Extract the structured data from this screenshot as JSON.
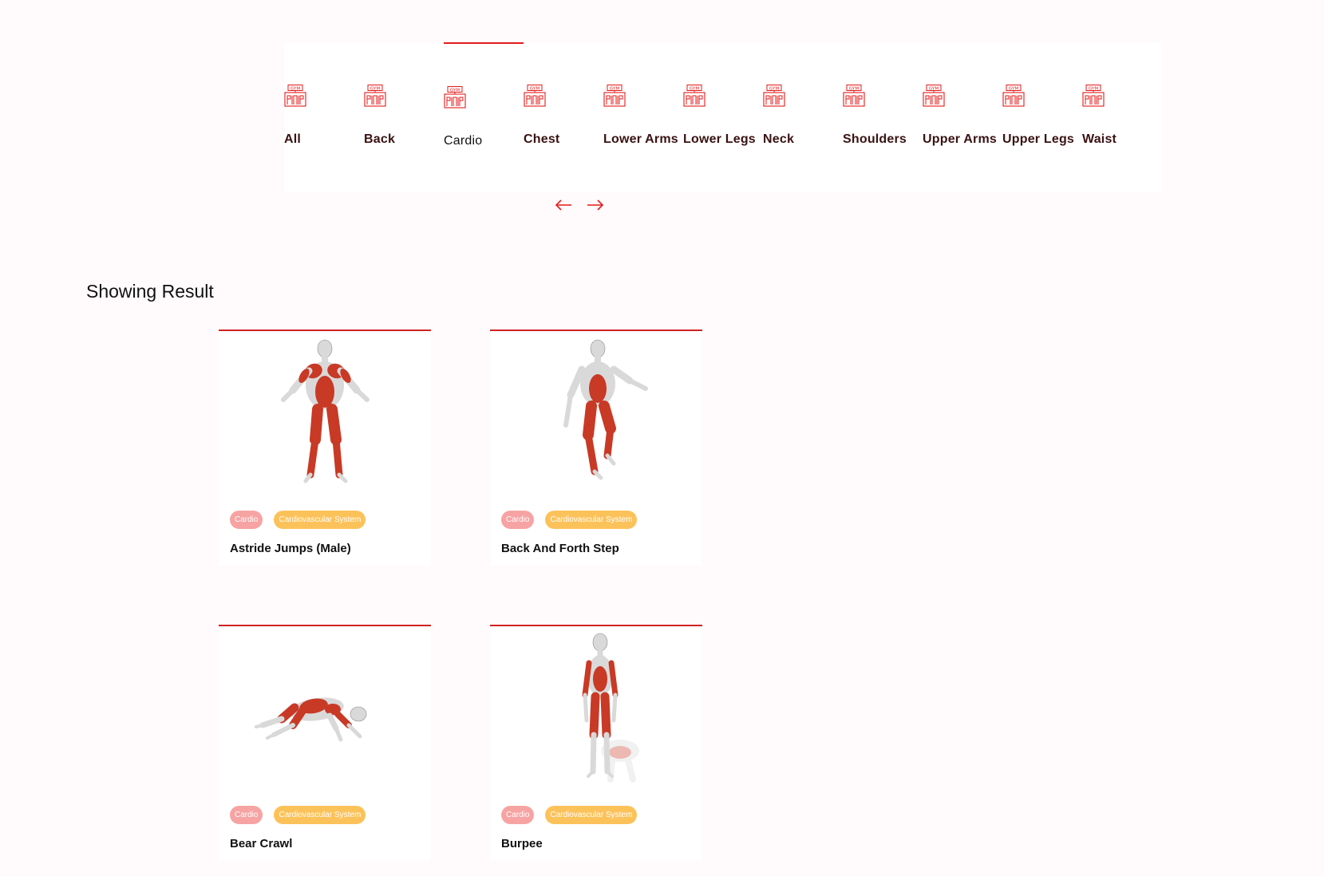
{
  "categories": [
    {
      "label": "All",
      "icon": "gym-equipment-icon"
    },
    {
      "label": "Back",
      "icon": "gym-equipment-icon"
    },
    {
      "label": "Cardio",
      "icon": "gym-equipment-icon",
      "active": true
    },
    {
      "label": "Chest",
      "icon": "gym-equipment-icon"
    },
    {
      "label": "Lower Arms",
      "icon": "gym-equipment-icon"
    },
    {
      "label": "Lower Legs",
      "icon": "gym-equipment-icon"
    },
    {
      "label": "Neck",
      "icon": "gym-equipment-icon"
    },
    {
      "label": "Shoulders",
      "icon": "gym-equipment-icon"
    },
    {
      "label": "Upper Arms",
      "icon": "gym-equipment-icon"
    },
    {
      "label": "Upper Legs",
      "icon": "gym-equipment-icon"
    },
    {
      "label": "Waist",
      "icon": "gym-equipment-icon"
    }
  ],
  "icon_badge_text": "GYM",
  "nav": {
    "prev_icon": "arrow-left-icon",
    "next_icon": "arrow-right-icon"
  },
  "results": {
    "title": "Showing Result",
    "exercises": [
      {
        "name": "Astride Jumps (Male)",
        "tags": [
          "Cardio",
          "Cardiovascular System"
        ],
        "pose": "standing-jump"
      },
      {
        "name": "Back And Forth Step",
        "tags": [
          "Cardio",
          "Cardiovascular System"
        ],
        "pose": "step-lunge"
      },
      {
        "name": "Bear Crawl",
        "tags": [
          "Cardio",
          "Cardiovascular System"
        ],
        "pose": "crawl"
      },
      {
        "name": "Burpee",
        "tags": [
          "Cardio",
          "Cardiovascular System"
        ],
        "pose": "burpee"
      }
    ]
  },
  "colors": {
    "accent": "#e41b1b",
    "card_border": "#d22121",
    "tag_primary": "#f7a3a3",
    "tag_secondary": "#fcc25a",
    "muscle": "#c83a26",
    "body": "#d9d9d9",
    "page_bg": "#fffafb"
  }
}
